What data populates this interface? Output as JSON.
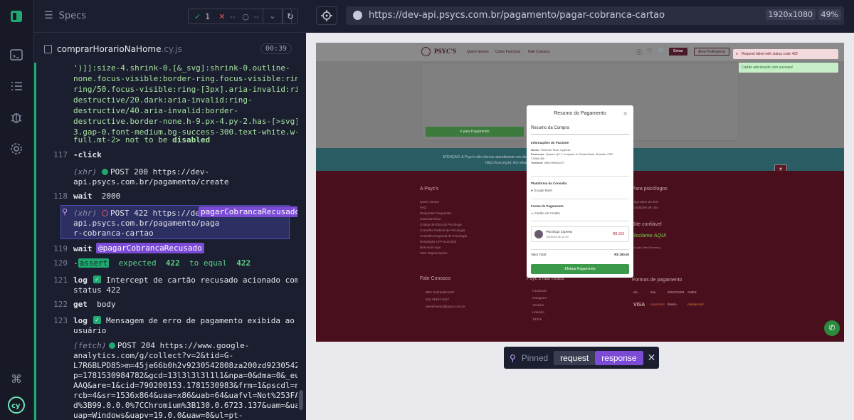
{
  "header": {
    "specs_label": "Specs",
    "passed": "1",
    "failed": "--",
    "pending": "--"
  },
  "file": {
    "name": "comprarHorarioNaHome",
    "ext": ".cy.js",
    "duration": "00:39"
  },
  "log_lines": [
    {
      "text": "')]]:size-4.shrink-0.[&_svg]:shrink-0.outline-"
    },
    {
      "text": "none.focus-visible:border-ring.focus-visible:ring-"
    },
    {
      "text": "ring/50.focus-visible:ring-[3px].aria-invalid:ring-"
    },
    {
      "text": "destructive/20.dark:aria-invalid:ring-"
    },
    {
      "text": "destructive/40.aria-invalid:border-"
    },
    {
      "text": "destructive.border-none.h-9.px-4.py-2.has-[>svg]:px-"
    },
    {
      "text": "3.gap-0.font-medium.bg-success-300.text-white.w-"
    }
  ],
  "line_last": "full.mt-2>",
  "line_last_tail": "not to be",
  "line_last_end": "disabled",
  "commands": {
    "c117": {
      "num": "117",
      "cmd": "-click"
    },
    "xhr1": {
      "head": "(xhr)",
      "method": "POST 200 https://dev-",
      "path": "api.psycs.com.br/pagamento/create"
    },
    "c118": {
      "num": "118",
      "cmd": "wait",
      "arg": "2000"
    },
    "xhr2": {
      "head": "(xhr)",
      "method": "POST 422 https://dev-",
      "alias": "pagarCobrancaRecusado",
      "l2": "api.psycs.com.br/pagamento/paga",
      "l3": "r-cobranca-cartao"
    },
    "c119": {
      "num": "119",
      "cmd": "wait",
      "alias": "@pagarCobrancaRecusado"
    },
    "c120": {
      "num": "120",
      "cmd": "-",
      "tag": "assert",
      "a": "expected",
      "b": "422",
      "c": "to equal",
      "d": "422"
    },
    "c121": {
      "num": "121",
      "cmd": "log",
      "msg1": "Intercept de cartão recusado acionado com",
      "msg2": "status 422"
    },
    "c122": {
      "num": "122",
      "cmd": "get",
      "arg": "body"
    },
    "c123": {
      "num": "123",
      "cmd": "log",
      "msg1": "Mensagem de erro de pagamento exibida ao",
      "msg2": "usuário"
    },
    "fetch": {
      "head": "(fetch)",
      "l1": "POST 204 https://www.google-",
      "l2": "analytics.com/g/collect?v=2&tid=G-",
      "l3": "L7R6BLPD85>m=45je66b0h2v9230542808za200zd92305428086_",
      "l4": "p=1781530984782&gcd=13l3l3l3l1l1&npa=0&dma=0&_eu=AAAA",
      "l5": "AAQ&are=1&cid=790200153.1781530983&frm=1&pscdl=noapi&",
      "l6": "rcb=4&sr=1536x864&uaa=x86&uab=64&uafvl=Not%253FA_Bran",
      "l7": "d%3B99.0.0.0%7CChromium%3B130.0.6723.137&uam=&uamb=0&",
      "l8": "uap=Windows&uapv=19.0.0&uaw=0&ul=pt-"
    }
  },
  "browser": {
    "url": "https://dev-api.psycs.com.br/pagamento/pagar-cobranca-cartao",
    "viewport": "1920x1080",
    "zoom": "49%"
  },
  "site": {
    "logo": "PSYC'S",
    "nav": [
      "Quem Somos",
      "Como Funciona",
      "Fale Conosco"
    ],
    "enter": "Entrar",
    "pro": "Área Profissional",
    "toast_err": "Request failed with status code 422",
    "toast_ok": "Cartão adicionado com sucesso!",
    "pay_btn": "ir para Pagamento",
    "attn": "ATENÇÃO: A Psyc's não oferece atendimento em situações de emergência. Em caso de risco de vida, ligue para o número 188 (CVV) ou acesse",
    "attn2": "https://cvv.org.br. Em situação de emergência, procure o hospital mais próximo.",
    "about_h": "A Psyc's",
    "about": [
      "Quem somos",
      "FAQ",
      "Perguntas Frequentes",
      "Canal de Ética",
      "Código de Ética do Psicólogo",
      "Conselho Federal de Psicologia",
      "Conselho Regional de Psicologia",
      "Resolução CFP 011/2018",
      "Denuncie Aqui",
      "Para Organizações"
    ],
    "psi_h": "Para psicólogos",
    "psi": [
      "Faça parte do time",
      "Condições de Uso"
    ],
    "safe_h": "Site confiável",
    "safe1": "Reclame AQUI",
    "safe2": "Google Safe Browsing",
    "contact_h": "Fale Conosco",
    "contact": [
      "BRA Sobradinho/DF",
      "(61) 98187-0117",
      "atendimento@psycs.com.br"
    ],
    "social_h": "Psyc's nas redes",
    "social": [
      "Facebook",
      "Instagram",
      "Youtube",
      "LinkedIn",
      "TikTok"
    ],
    "payf_h": "Formas de pagamento",
    "cards": [
      "elo",
      "Itaú",
      "DISCOVER",
      "AMEX",
      "VISA",
      "Hipercard",
      "Boleto",
      "mastercard"
    ]
  },
  "modal": {
    "title": "Resumo do Pagamento",
    "section": "Resumo da Compra",
    "patient_h": "Informações do Paciente",
    "name_l": "Nome:",
    "name": "Paciente Teste Cypress",
    "addr_l": "Endereço:",
    "addr": "Quadra QC 2 Conjunto H, Santa Maria, Brasília, CEP 72556-080",
    "phone_l": "Telefone:",
    "phone": "5561998554477",
    "platform_h": "Plataforma da Consulta",
    "platform": "Google Meet",
    "payform_h": "Forma de Pagamento",
    "payform": "Cartão de Crédito",
    "psych": "Psicólogo Cypress",
    "date": "15/06/26 às 14:00",
    "price": "R$ 150",
    "total_l": "Valor Total:",
    "total": "R$ 150,00",
    "btn": "Efetuar Pagamento"
  },
  "pinned": {
    "label": "Pinned",
    "request": "request",
    "response": "response"
  }
}
